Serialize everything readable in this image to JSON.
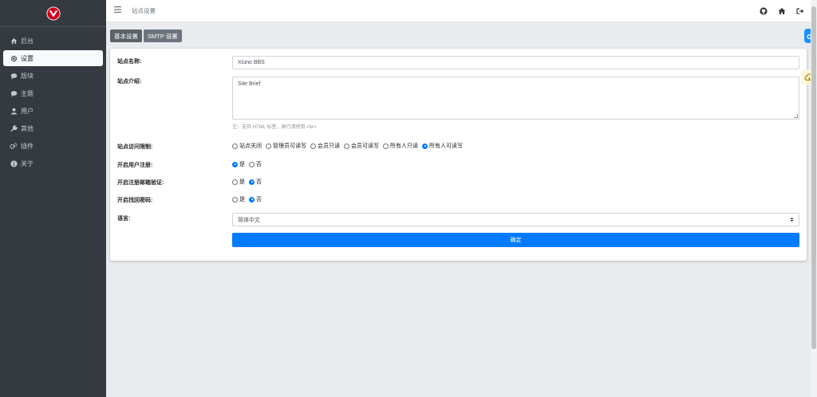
{
  "sidebar": {
    "items": [
      {
        "label": "后台",
        "icon": "home-icon"
      },
      {
        "label": "设置",
        "icon": "gear-icon",
        "active": true
      },
      {
        "label": "版块",
        "icon": "comment-icon"
      },
      {
        "label": "主题",
        "icon": "comment-icon"
      },
      {
        "label": "用户",
        "icon": "user-icon"
      },
      {
        "label": "其他",
        "icon": "wrench-icon"
      },
      {
        "label": "插件",
        "icon": "cogs-icon"
      },
      {
        "label": "关于",
        "icon": "info-icon"
      }
    ]
  },
  "topbar": {
    "title": "站点设置"
  },
  "tabs": [
    "基本设置",
    "SMTP 设置"
  ],
  "form": {
    "site_name_label": "站点名称:",
    "site_name_value": "Xiuno BBS",
    "site_brief_label": "站点介绍:",
    "site_brief_value": "Site Brief",
    "site_brief_help": "注：支持 HTML 标签，换行请使用 <br>",
    "access_label": "站点访问限制:",
    "access_options": [
      "站点关闭",
      "管理员可读写",
      "会员只读",
      "会员可读写",
      "所有人只读",
      "所有人可读写"
    ],
    "access_selected": 5,
    "register_label": "开启用户注册:",
    "register_options": [
      "是",
      "否"
    ],
    "register_selected": 0,
    "email_verify_label": "开启注册邮箱验证:",
    "email_verify_options": [
      "是",
      "否"
    ],
    "email_verify_selected": 1,
    "find_pw_label": "开启找回密码:",
    "find_pw_options": [
      "是",
      "否"
    ],
    "find_pw_selected": 1,
    "lang_label": "语言:",
    "lang_value": "简体中文",
    "submit_label": "确定"
  },
  "colors": {
    "sidebar_bg": "#343a40",
    "accent": "#007bff",
    "logo_red": "#d0021b"
  }
}
